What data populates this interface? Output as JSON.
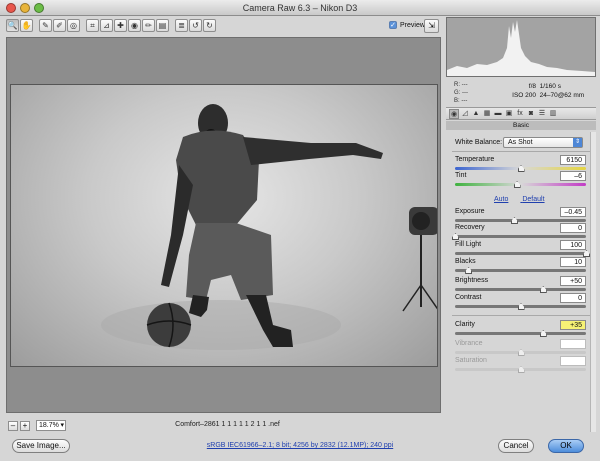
{
  "window": {
    "title": "Camera Raw 6.3  –  Nikon D3"
  },
  "toolbar": {
    "tools": [
      {
        "name": "zoom-tool",
        "icon": "zoom-icon",
        "glyph": "🔍"
      },
      {
        "name": "hand-tool",
        "icon": "hand-icon",
        "glyph": "✋"
      },
      {
        "name": "white-balance-tool",
        "icon": "eyedropper-icon",
        "glyph": "✎"
      },
      {
        "name": "color-sampler-tool",
        "icon": "sampler-icon",
        "glyph": "✐"
      },
      {
        "name": "targeted-adjustment-tool",
        "icon": "target-icon",
        "glyph": "◎"
      },
      {
        "name": "crop-tool",
        "icon": "crop-icon",
        "glyph": "⌗"
      },
      {
        "name": "straighten-tool",
        "icon": "straighten-icon",
        "glyph": "⊿"
      },
      {
        "name": "spot-removal-tool",
        "icon": "spot-icon",
        "glyph": "✚"
      },
      {
        "name": "red-eye-tool",
        "icon": "eye-icon",
        "glyph": "◉"
      },
      {
        "name": "adjustment-brush-tool",
        "icon": "brush-icon",
        "glyph": "✏"
      },
      {
        "name": "graduated-filter-tool",
        "icon": "gradient-icon",
        "glyph": "▤"
      },
      {
        "name": "preferences-tool",
        "icon": "list-icon",
        "glyph": "≣"
      },
      {
        "name": "rotate-left-tool",
        "icon": "rotate-left-icon",
        "glyph": "↺"
      },
      {
        "name": "rotate-right-tool",
        "icon": "rotate-right-icon",
        "glyph": "↻"
      }
    ],
    "preview_label": "Preview"
  },
  "readout": {
    "r": "R:   ---",
    "g": "G:   ---",
    "b": "B:   ---",
    "aperture": "f/8",
    "shutter": "1/160 s",
    "iso": "ISO 200",
    "lens": "24–70@62 mm"
  },
  "panel": {
    "title": "Basic",
    "white_balance_label": "White Balance:",
    "white_balance_value": "As Shot",
    "auto_link": "Auto",
    "default_link": "Default",
    "sliders": {
      "temperature": {
        "label": "Temperature",
        "value": "6150",
        "pos": 0.5
      },
      "tint": {
        "label": "Tint",
        "value": "–6",
        "pos": 0.47
      },
      "exposure": {
        "label": "Exposure",
        "value": "–0.45",
        "pos": 0.45
      },
      "recovery": {
        "label": "Recovery",
        "value": "0",
        "pos": 0.0
      },
      "fill_light": {
        "label": "Fill Light",
        "value": "100",
        "pos": 1.0
      },
      "blacks": {
        "label": "Blacks",
        "value": "10",
        "pos": 0.1
      },
      "brightness": {
        "label": "Brightness",
        "value": "+50",
        "pos": 0.67
      },
      "contrast": {
        "label": "Contrast",
        "value": "0",
        "pos": 0.5
      },
      "clarity": {
        "label": "Clarity",
        "value": "+35",
        "pos": 0.67
      },
      "vibrance": {
        "label": "Vibrance",
        "value": "",
        "pos": 0.5
      },
      "saturation": {
        "label": "Saturation",
        "value": "",
        "pos": 0.5
      }
    }
  },
  "footer": {
    "zoom_value": "18.7%",
    "filename": "Comfort–2861 1 1 1 1 1 2 1 1 .nef",
    "save_label": "Save Image...",
    "workflow_info": "sRGB IEC61966–2.1; 8 bit; 4256 by 2832 (12.1MP); 240 ppi",
    "cancel_label": "Cancel",
    "ok_label": "OK"
  }
}
